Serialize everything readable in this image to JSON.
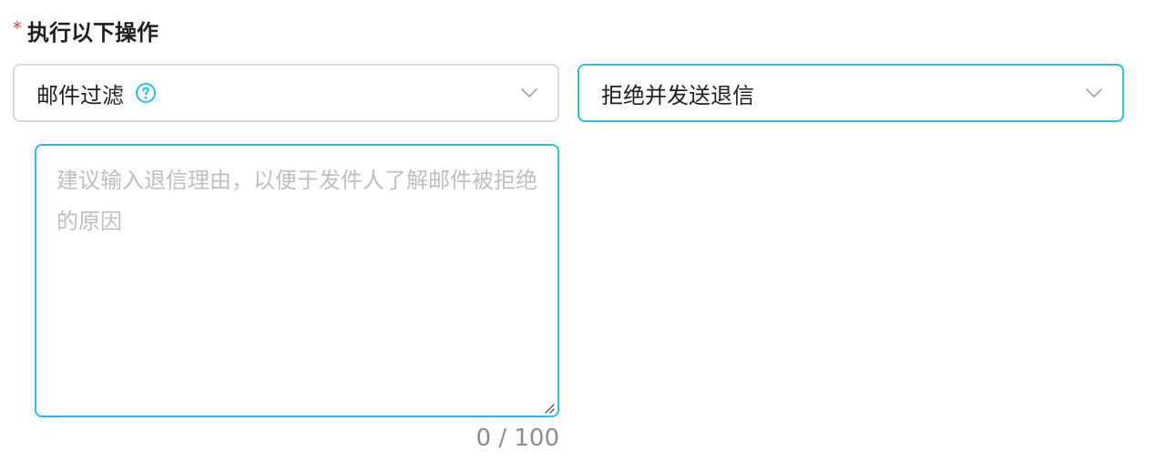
{
  "form": {
    "label": "执行以下操作",
    "required_mark": "*"
  },
  "filter_select": {
    "value": "邮件过滤",
    "help_icon": "question-circle-icon",
    "chevron_icon": "chevron-down-icon"
  },
  "action_select": {
    "value": "拒绝并发送退信",
    "chevron_icon": "chevron-down-icon"
  },
  "reason_textarea": {
    "value": "",
    "placeholder": "建议输入退信理由，以便于发件人了解邮件被拒绝的原因",
    "counter": "0 / 100"
  },
  "colors": {
    "accent": "#22c3e6",
    "required": "#f04c4c",
    "border": "#d9d9d9",
    "placeholder": "#bfbfbf"
  }
}
